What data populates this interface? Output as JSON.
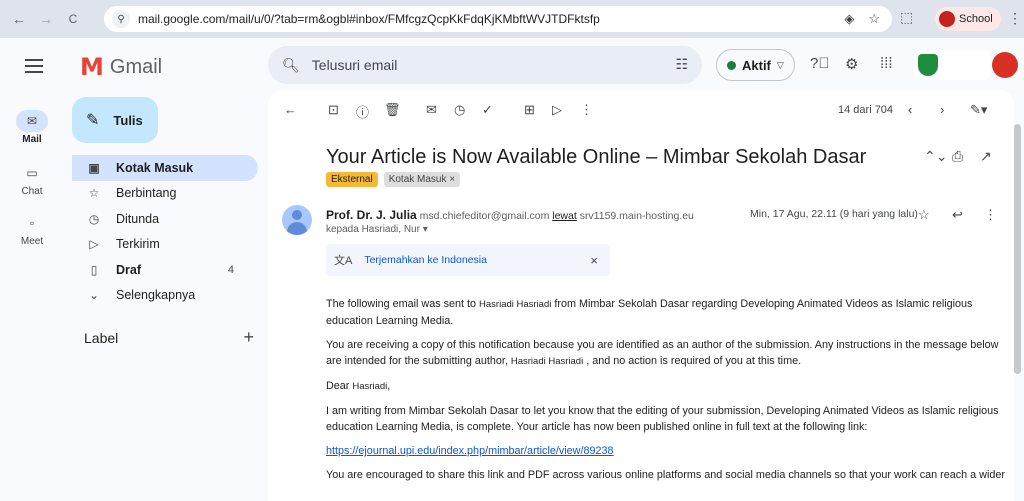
{
  "browser": {
    "url": "mail.google.com/mail/u/0/?tab=rm&ogbl#inbox/FMfcgzQcpKkFdqKjKMbftWVJTDFktsfp",
    "profile_label": "School",
    "back": "←",
    "forward": "→",
    "reload": "C",
    "site_info": "⚲",
    "menu": "⋮"
  },
  "header": {
    "app_name": "Gmail",
    "logo_letter": "M",
    "search_placeholder": "Telusuri email",
    "status_label": "Aktif"
  },
  "rail": [
    {
      "label": "Mail",
      "icon": "mail-icon",
      "glyph": "✉"
    },
    {
      "label": "Chat",
      "icon": "chat-icon",
      "glyph": "▭"
    },
    {
      "label": "Meet",
      "icon": "video-icon",
      "glyph": "▫"
    }
  ],
  "sidebar": {
    "compose_label": "Tulis",
    "items": [
      {
        "label": "Kotak Masuk",
        "icon": "inbox-icon",
        "glyph": "▣",
        "count": ""
      },
      {
        "label": "Berbintang",
        "icon": "star-icon",
        "glyph": "☆",
        "count": ""
      },
      {
        "label": "Ditunda",
        "icon": "clock-icon",
        "glyph": "◷",
        "count": ""
      },
      {
        "label": "Terkirim",
        "icon": "send-icon",
        "glyph": "▷",
        "count": ""
      },
      {
        "label": "Draf",
        "icon": "draft-icon",
        "glyph": "▯",
        "count": "4"
      },
      {
        "label": "Selengkapnya",
        "icon": "chevron-down-icon",
        "glyph": "⌄",
        "count": ""
      }
    ],
    "labels_header": "Label",
    "labels_add": "+"
  },
  "message": {
    "pager": "14 dari 704",
    "subject": "Your Article is Now Available Online – Mimbar Sekolah Dasar",
    "tag_external": "Eksternal",
    "tag_inbox": "Kotak Masuk ×",
    "sender_name": "Prof. Dr. J. Julia",
    "sender_email": "msd.chiefeditor@gmail.com",
    "via": "lewat",
    "via_host": "srv1159.main-hosting.eu",
    "recipient": "kepada Hasriadi, Nur ▾",
    "date": "Min, 17 Agu, 22.11 (9 hari yang lalu)",
    "translate_label": "Terjemahkan ke Indonesia",
    "body": {
      "p1a": "The following email was sent to",
      "p1_name": "Hasriadi Hasriadi",
      "p1b": "from Mimbar Sekolah Dasar regarding Developing Animated Videos as Islamic religious education Learning Media.",
      "p2a": "You are receiving a copy of this notification because you are identified as an author of the submission. Any instructions in the message below are intended for the submitting author,",
      "p2_name": "Hasriadi Hasriadi",
      "p2b": ", and no action is required of you at this time.",
      "dear": "Dear",
      "dear_name": "Hasriadi",
      "dear_comma": ",",
      "p3": "I am writing from Mimbar Sekolah Dasar to let you know that the editing of your submission, Developing Animated Videos as Islamic religious education Learning Media, is complete. Your article has now been published online in full text at the following link:",
      "link": "https://ejournal.upi.edu/index.php/mimbar/article/view/89238",
      "p4": "You are encouraged to share this link and PDF across various online platforms and social media channels so that your work can reach a wider"
    }
  },
  "colors": {
    "accent": "#0b57d0",
    "compose_bg": "#c2e7ff",
    "active_nav": "#d3e3fd",
    "tag_external": "#f6b936",
    "status_green": "#188038"
  }
}
